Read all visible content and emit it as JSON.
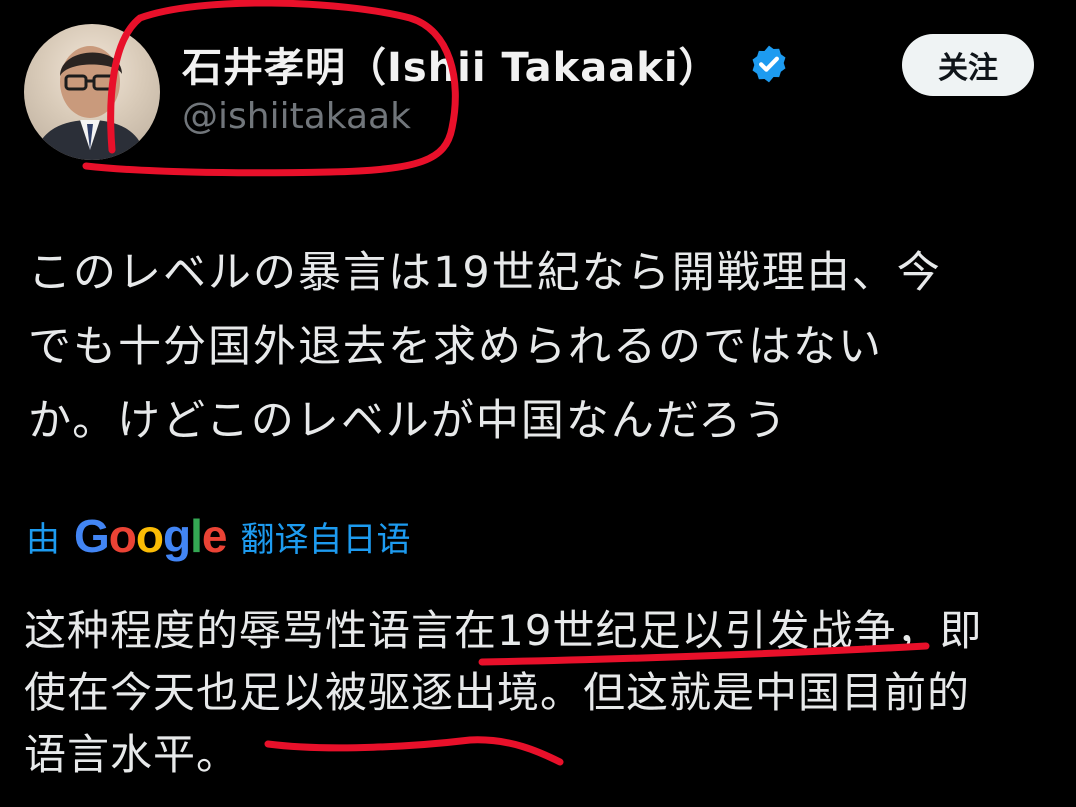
{
  "header": {
    "display_name": "石井孝明（Ishii Takaaki）",
    "handle": "@ishiitakaak",
    "follow_label": "关注"
  },
  "icons": {
    "avatar": "profile-photo",
    "verified": "verified-badge-icon"
  },
  "post": {
    "original_lines": [
      "このレベルの暴言は19世紀なら開戦理由、今",
      "でも十分国外退去を求められるのではない",
      "か。けどこのレベルが中国なんだろう"
    ],
    "translation_prefix": "由",
    "translation_brand": "Google",
    "translation_suffix": "翻译自日语",
    "translated_lines": [
      "这种程度的辱骂性语言在19世纪足以引发战争，即",
      "使在今天也足以被驱逐出境。但这就是中国目前的",
      "语言水平。"
    ]
  },
  "colors": {
    "background": "#000000",
    "text": "#e7e9ea",
    "muted": "#71767b",
    "link": "#1d9bf0",
    "verified": "#1d9bf0",
    "annotation": "#e8102a"
  }
}
